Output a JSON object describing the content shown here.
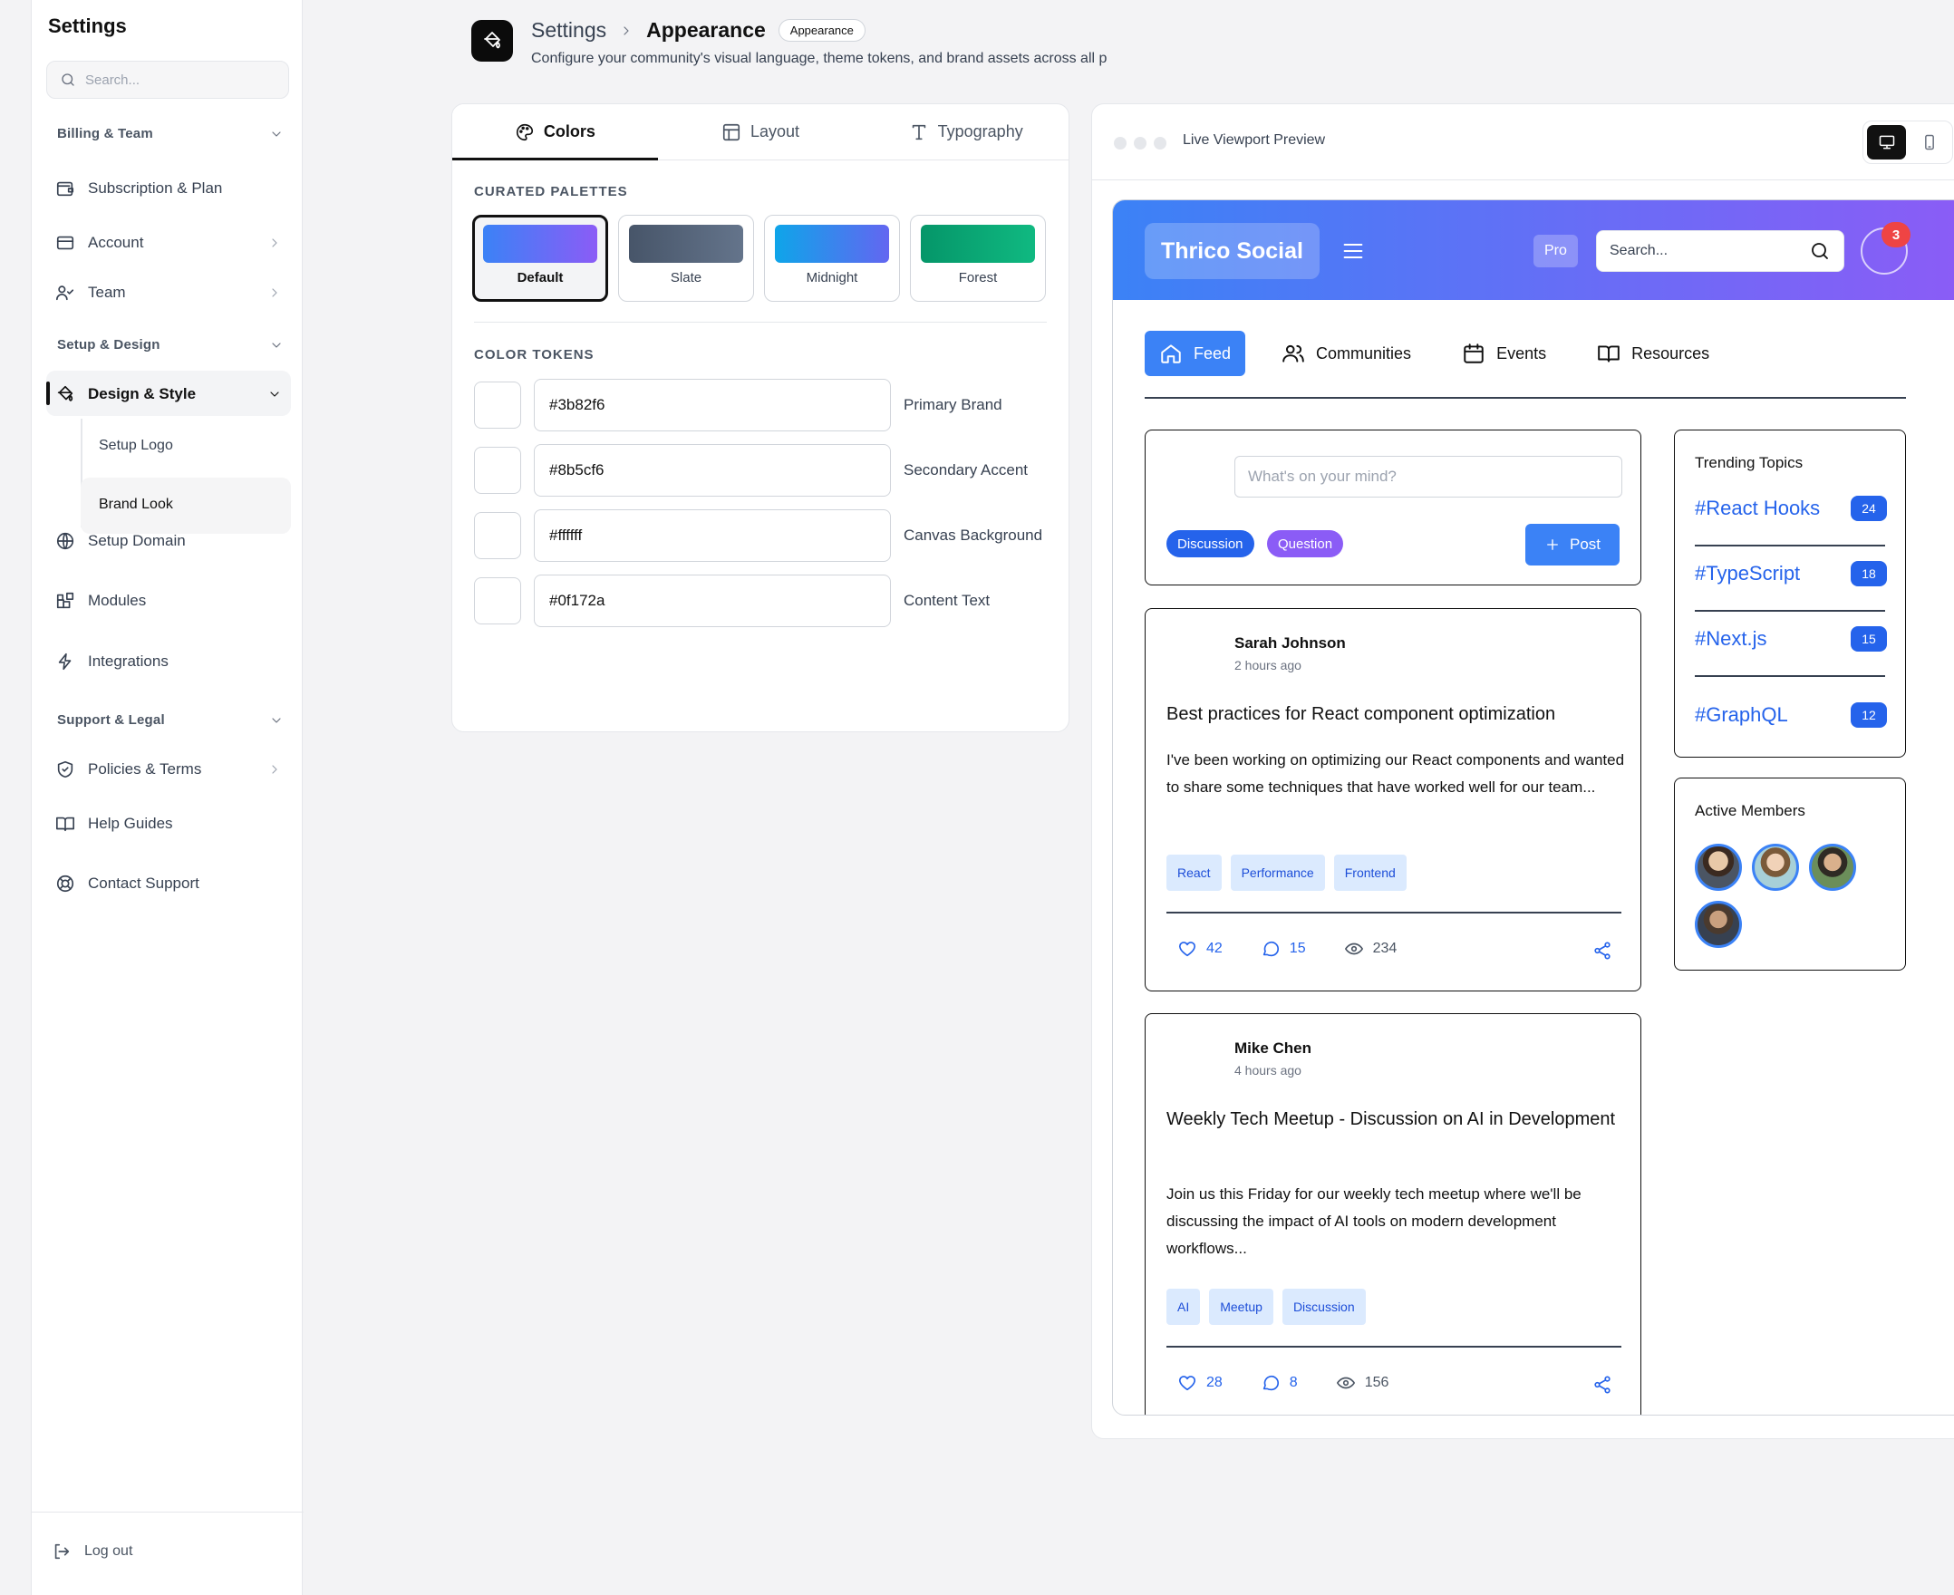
{
  "sidebar": {
    "title": "Settings",
    "search_placeholder": "Search...",
    "sections": [
      {
        "label": "Billing & Team"
      },
      {
        "label": "Setup & Design"
      },
      {
        "label": "Support & Legal"
      }
    ],
    "items": {
      "subscription": "Subscription & Plan",
      "account": "Account",
      "team": "Team",
      "design_style": "Design & Style",
      "setup_logo": "Setup Logo",
      "brand_look": "Brand Look",
      "setup_domain": "Setup Domain",
      "modules": "Modules",
      "integrations": "Integrations",
      "policies": "Policies & Terms",
      "help": "Help Guides",
      "contact": "Contact Support"
    },
    "logout": "Log out"
  },
  "header": {
    "breadcrumb_root": "Settings",
    "breadcrumb_current": "Appearance",
    "badge": "Appearance",
    "subtitle": "Configure your community's visual language, theme tokens, and brand assets across all p"
  },
  "settings_card": {
    "tabs": [
      "Colors",
      "Layout",
      "Typography"
    ],
    "active_tab": "Colors",
    "palettes_label": "CURATED PALETTES",
    "palettes": [
      {
        "name": "Default",
        "from": "#3b82f6",
        "to": "#8b5cf6",
        "selected": true
      },
      {
        "name": "Slate",
        "from": "#475569",
        "to": "#64748b",
        "selected": false
      },
      {
        "name": "Midnight",
        "from": "#0ea5e9",
        "to": "#6366f1",
        "selected": false
      },
      {
        "name": "Forest",
        "from": "#059669",
        "to": "#10b981",
        "selected": false
      }
    ],
    "tokens_label": "COLOR TOKENS",
    "tokens": [
      {
        "value": "#3b82f6",
        "label": "Primary Brand"
      },
      {
        "value": "#8b5cf6",
        "label": "Secondary Accent"
      },
      {
        "value": "#ffffff",
        "label": "Canvas Background"
      },
      {
        "value": "#0f172a",
        "label": "Content Text"
      }
    ]
  },
  "preview": {
    "title": "Live Viewport Preview",
    "app": {
      "brand": "Thrico Social",
      "pro_badge": "Pro",
      "search_placeholder": "Search...",
      "notification_count": "3",
      "nav": [
        "Feed",
        "Communities",
        "Events",
        "Resources"
      ],
      "compose_placeholder": "What's on your mind?",
      "compose_tags": [
        "Discussion",
        "Question"
      ],
      "post_button": "Post",
      "posts": [
        {
          "author": "Sarah Johnson",
          "time": "2 hours ago",
          "title": "Best practices for React component optimization",
          "body": "I've been working on optimizing our React components and wanted to share some techniques that have worked well for our team...",
          "tags": [
            "React",
            "Performance",
            "Frontend"
          ],
          "likes": "42",
          "comments": "15",
          "views": "234"
        },
        {
          "author": "Mike Chen",
          "time": "4 hours ago",
          "title": "Weekly Tech Meetup - Discussion on AI in Development",
          "body": "Join us this Friday for our weekly tech meetup where we'll be discussing the impact of AI tools on modern development workflows...",
          "tags": [
            "AI",
            "Meetup",
            "Discussion"
          ],
          "likes": "28",
          "comments": "8",
          "views": "156"
        }
      ],
      "trending_title": "Trending Topics",
      "trending": [
        {
          "topic": "#React Hooks",
          "count": "24"
        },
        {
          "topic": "#TypeScript",
          "count": "18"
        },
        {
          "topic": "#Next.js",
          "count": "15"
        },
        {
          "topic": "#GraphQL",
          "count": "12"
        }
      ],
      "members_title": "Active Members"
    }
  },
  "colors": {
    "primary": "#3b82f6",
    "secondary": "#8b5cf6",
    "chip_discussion": "#2563eb",
    "chip_question": "#8b5cf6"
  }
}
